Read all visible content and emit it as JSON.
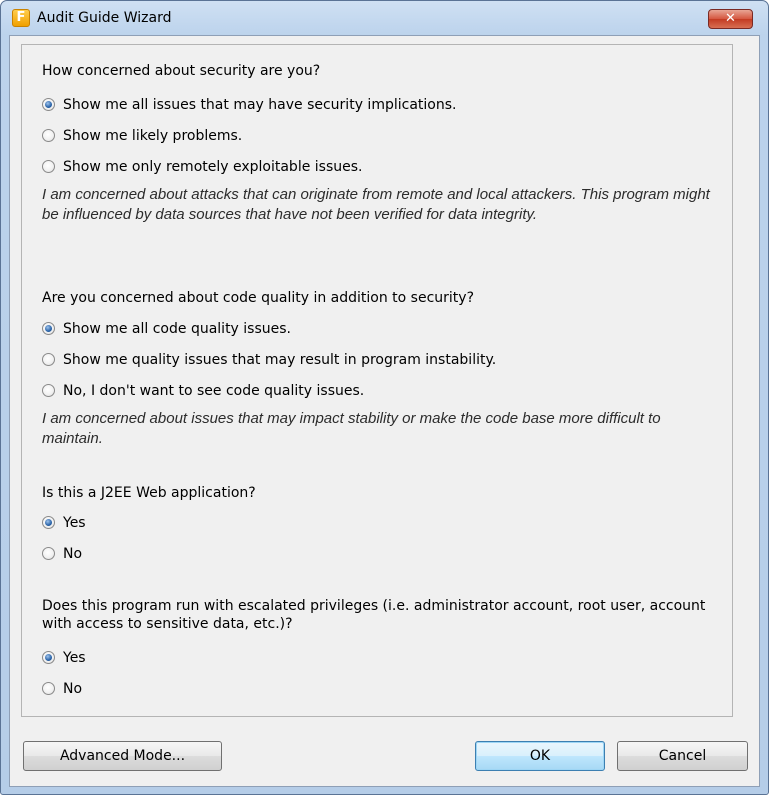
{
  "window": {
    "title": "Audit Guide Wizard",
    "app_icon_letter": "F",
    "close_symbol": "✕"
  },
  "questions": [
    {
      "text": "How concerned about security are you?",
      "options": [
        {
          "label": "Show me all issues that may have security implications.",
          "checked": true
        },
        {
          "label": "Show me likely problems.",
          "checked": false
        },
        {
          "label": "Show me only remotely exploitable issues.",
          "checked": false
        }
      ],
      "description": "I am concerned about attacks that can originate from remote and local attackers. This program might be influenced by data sources that have not been verified for data integrity."
    },
    {
      "text": "Are you concerned about code quality in addition to security?",
      "options": [
        {
          "label": "Show me all code quality issues.",
          "checked": true
        },
        {
          "label": "Show me quality issues that may result in program instability.",
          "checked": false
        },
        {
          "label": "No, I don't want to see code quality issues.",
          "checked": false
        }
      ],
      "description": "I am concerned about issues that may impact stability or make the code base more difficult to maintain."
    },
    {
      "text": "Is this a J2EE Web application?",
      "options": [
        {
          "label": "Yes",
          "checked": true
        },
        {
          "label": "No",
          "checked": false
        }
      ]
    },
    {
      "text": "Does this program run with escalated privileges (i.e. administrator account, root user, account with access to sensitive data, etc.)?",
      "options": [
        {
          "label": "Yes",
          "checked": true
        },
        {
          "label": "No",
          "checked": false
        }
      ]
    }
  ],
  "buttons": {
    "advanced": "Advanced Mode...",
    "ok": "OK",
    "cancel": "Cancel"
  },
  "colors": {
    "titlebar": "#bcd3ec",
    "close_button": "#c33b22",
    "dialog_background": "#f0f0f0",
    "radio_selected": "#2a63a8",
    "default_button": "#bee6fd"
  },
  "icons": {
    "app": "fortify-app-icon",
    "close": "close-icon"
  }
}
